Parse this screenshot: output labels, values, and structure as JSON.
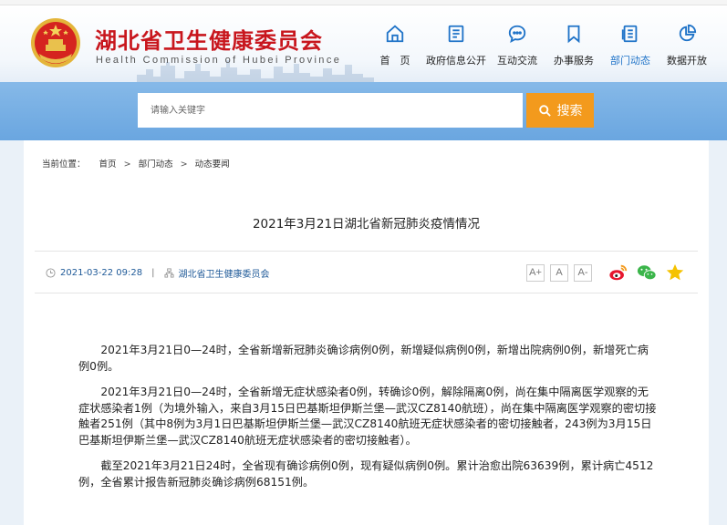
{
  "site": {
    "title_cn": "湖北省卫生健康委员会",
    "title_en": "Health Commission of Hubei Province"
  },
  "nav": {
    "items": [
      {
        "label": "首　页",
        "icon": "home-icon"
      },
      {
        "label": "政府信息公开",
        "icon": "document-icon"
      },
      {
        "label": "互动交流",
        "icon": "chat-icon"
      },
      {
        "label": "办事服务",
        "icon": "bookmark-icon"
      },
      {
        "label": "部门动态",
        "icon": "news-icon",
        "active": true
      },
      {
        "label": "数据开放",
        "icon": "pie-chart-icon"
      }
    ],
    "active_color": "#1f73c8"
  },
  "search": {
    "placeholder": "请输入关键字",
    "button_label": "搜索"
  },
  "breadcrumb": {
    "lead": "当前位置：",
    "items": [
      "首页",
      "部门动态",
      "动态要闻"
    ],
    "separator": ">"
  },
  "article": {
    "title": "2021年3月21日湖北省新冠肺炎疫情情况",
    "date": "2021-03-22 09:28",
    "separator": "|",
    "source": "湖北省卫生健康委员会",
    "font_buttons": [
      "A+",
      "A",
      "A-"
    ],
    "paragraphs": [
      "2021年3月21日0—24时，全省新增新冠肺炎确诊病例0例，新增疑似病例0例，新增出院病例0例，新增死亡病例0例。",
      "2021年3月21日0—24时，全省新增无症状感染者0例，转确诊0例，解除隔离0例，尚在集中隔离医学观察的无症状感染者1例（为境外输入，来自3月15日巴基斯坦伊斯兰堡—武汉CZ8140航班），尚在集中隔离医学观察的密切接触者251例（其中8例为3月1日巴基斯坦伊斯兰堡—武汉CZ8140航班无症状感染者的密切接触者，243例为3月15日巴基斯坦伊斯兰堡—武汉CZ8140航班无症状感染者的密切接触者）。",
      "截至2021年3月21日24时，全省现有确诊病例0例，现有疑似病例0例。累计治愈出院63639例，累计病亡4512例，全省累计报告新冠肺炎确诊病例68151例。"
    ]
  },
  "share_icons": [
    "weibo-icon",
    "wechat-icon",
    "favorite-star-icon"
  ],
  "colors": {
    "brand_red": "#c8161d",
    "search_button": "#f39a1d",
    "search_band": "#6aa6e0",
    "link_blue": "#1f5a98"
  }
}
